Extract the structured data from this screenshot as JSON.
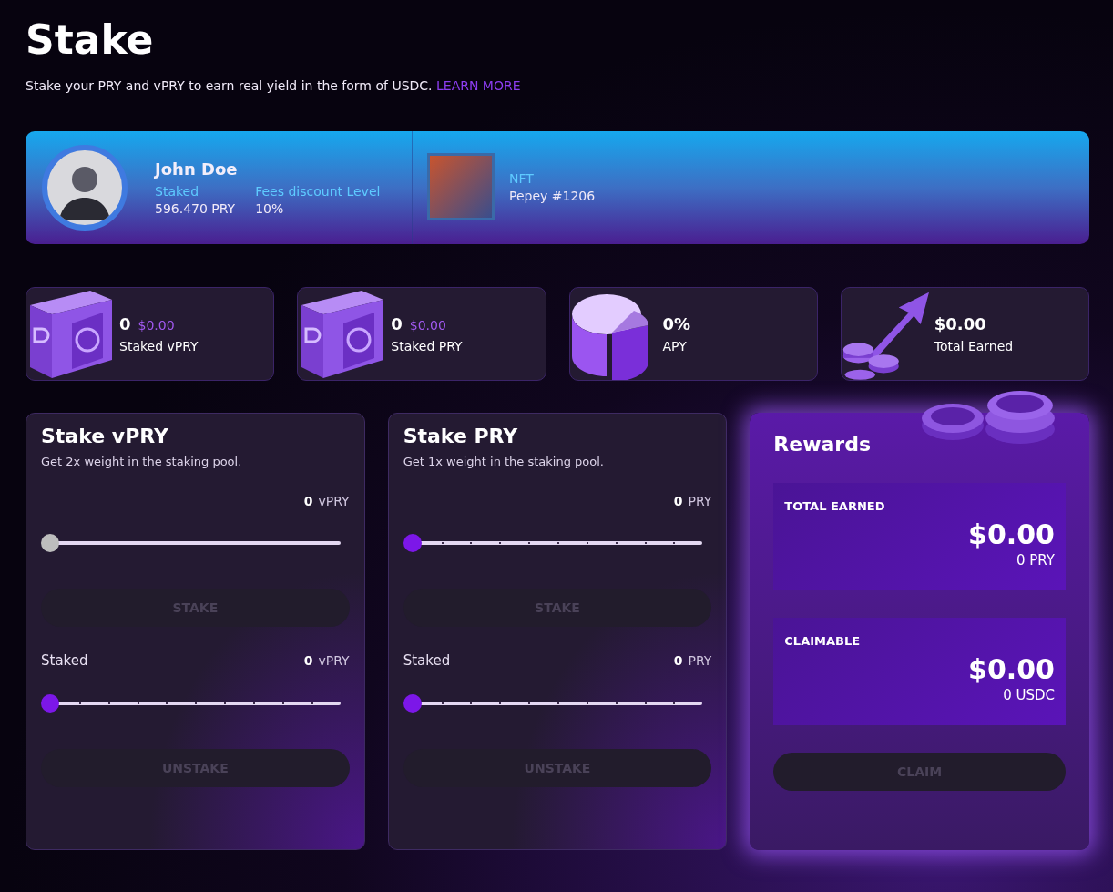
{
  "page": {
    "title": "Stake",
    "subtitle": "Stake your PRY and vPRY to earn real yield in the form of USDC.",
    "learn_more_link": "LEARN MORE"
  },
  "profile": {
    "name": "John Doe",
    "stats": [
      {
        "label": "Staked",
        "value": "596.470 PRY"
      },
      {
        "label": "Fees discount Level",
        "value": "10%"
      }
    ],
    "nft": {
      "label": "NFT",
      "value": "Pepey #1206"
    }
  },
  "stat_cards": [
    {
      "kind": "safe",
      "value": "0",
      "usd": "$0.00",
      "label": "Staked vPRY"
    },
    {
      "kind": "safe",
      "value": "0",
      "usd": "$0.00",
      "label": "Staked PRY"
    },
    {
      "kind": "pie",
      "value": "0%",
      "label": "APY"
    },
    {
      "kind": "arrow",
      "value": "$0.00",
      "label": "Total Earned"
    }
  ],
  "stake_panels": [
    {
      "title": "Stake vPRY",
      "description": "Get 2x weight in the staking pool.",
      "amount": {
        "value": "0",
        "unit": "vPRY"
      },
      "stake_slider": {
        "kind": "plain",
        "level": 0
      },
      "stake_button": {
        "label": "STAKE",
        "disabled": true
      },
      "staked_label": "Staked",
      "staked": {
        "value": "0",
        "unit": "vPRY"
      },
      "unstake_slider": {
        "kind": "stepped",
        "level": 0
      },
      "unstake_button": {
        "label": "UNSTAKE",
        "disabled": true
      }
    },
    {
      "title": "Stake PRY",
      "description": "Get 1x weight in the staking pool.",
      "amount": {
        "value": "0",
        "unit": "PRY"
      },
      "stake_slider": {
        "kind": "stepped",
        "level": 0
      },
      "stake_button": {
        "label": "STAKE",
        "disabled": true
      },
      "staked_label": "Staked",
      "staked": {
        "value": "0",
        "unit": "PRY"
      },
      "unstake_slider": {
        "kind": "stepped",
        "level": 0
      },
      "unstake_button": {
        "label": "UNSTAKE",
        "disabled": true
      }
    }
  ],
  "rewards": {
    "title": "Rewards",
    "boxes": [
      {
        "label": "TOTAL EARNED",
        "value": "$0.00",
        "sub": "0 PRY"
      },
      {
        "label": "CLAIMABLE",
        "value": "$0.00",
        "sub": "0 USDC"
      }
    ],
    "claim_button": {
      "label": "CLAIM",
      "disabled": true
    }
  }
}
